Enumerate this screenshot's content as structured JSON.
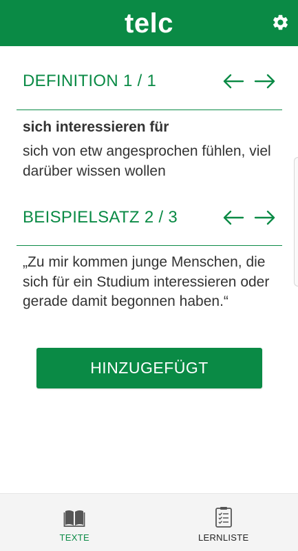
{
  "header": {
    "title": "telc",
    "settings_icon": "gear-icon"
  },
  "definition_section": {
    "title": "DEFINITION 1 / 1",
    "prev_icon": "arrow-left-icon",
    "next_icon": "arrow-right-icon"
  },
  "entry": {
    "term": "sich interessieren für",
    "definition": "sich von etw angesprochen fühlen, viel darüber wissen wollen"
  },
  "example_section": {
    "title": "BEISPIELSATZ 2 / 3",
    "prev_icon": "arrow-left-icon",
    "next_icon": "arrow-right-icon",
    "sentence": "„Zu mir kommen junge Menschen, die sich für ein Studium interessieren oder gerade damit begonnen haben.“"
  },
  "add_button": {
    "label": "HINZUGEFÜGT"
  },
  "bottom_nav": {
    "items": [
      {
        "label": "TEXTE",
        "icon": "book-icon",
        "active": true
      },
      {
        "label": "LERNLISTE",
        "icon": "checklist-icon",
        "active": false
      }
    ]
  },
  "colors": {
    "brand_green": "#0a8a45",
    "text": "#333333",
    "nav_background": "#f4f4f4"
  }
}
